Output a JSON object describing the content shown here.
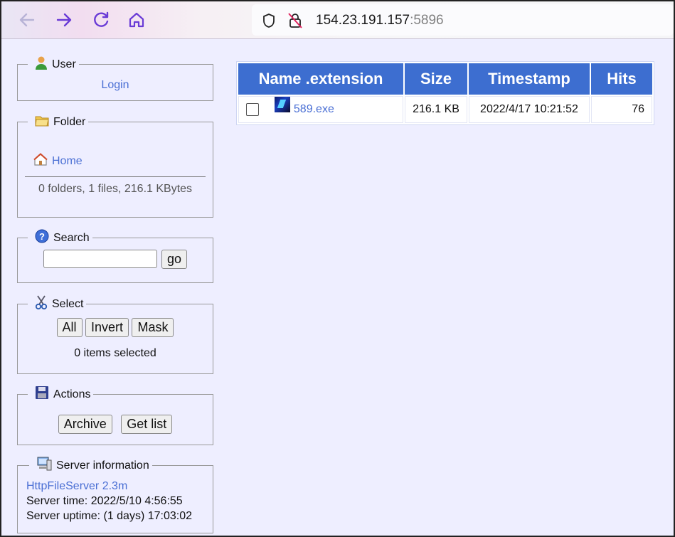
{
  "browser": {
    "url_host": "154.23.191.157",
    "url_port": ":5896"
  },
  "user_panel": {
    "title": "User",
    "login_label": "Login"
  },
  "folder_panel": {
    "title": "Folder",
    "home_label": "Home",
    "summary": "0 folders, 1 files, 216.1 KBytes"
  },
  "search_panel": {
    "title": "Search",
    "input_value": "",
    "go_label": "go"
  },
  "select_panel": {
    "title": "Select",
    "all_label": "All",
    "invert_label": "Invert",
    "mask_label": "Mask",
    "status": "0 items selected"
  },
  "actions_panel": {
    "title": "Actions",
    "archive_label": "Archive",
    "getlist_label": "Get list"
  },
  "server_panel": {
    "title": "Server information",
    "software": "HttpFileServer 2.3m",
    "server_time": "Server time: 2022/5/10 4:56:55",
    "server_uptime": "Server uptime: (1 days) 17:03:02"
  },
  "file_table": {
    "headers": {
      "name": "Name .extension",
      "size": "Size",
      "timestamp": "Timestamp",
      "hits": "Hits"
    },
    "rows": [
      {
        "name": "589.exe",
        "size": "216.1 KB",
        "timestamp": "2022/4/17 10:21:52",
        "hits": "76"
      }
    ]
  },
  "colors": {
    "header_bg": "#3d6ed0",
    "link": "#4a6fd4",
    "page_bg": "#eeeeff"
  }
}
